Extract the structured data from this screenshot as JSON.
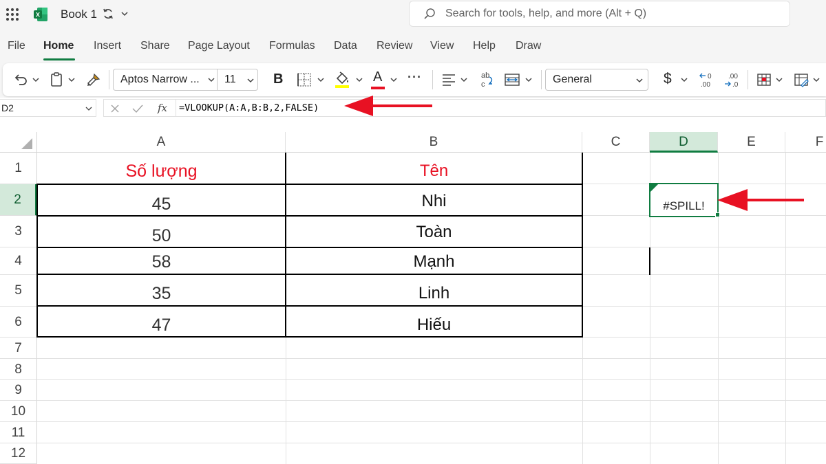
{
  "app": {
    "doc_title": "Book 1",
    "search_placeholder": "Search for tools, help, and more (Alt + Q)"
  },
  "tabs": [
    {
      "label": "File"
    },
    {
      "label": "Home"
    },
    {
      "label": "Insert"
    },
    {
      "label": "Share"
    },
    {
      "label": "Page Layout"
    },
    {
      "label": "Formulas"
    },
    {
      "label": "Data"
    },
    {
      "label": "Review"
    },
    {
      "label": "View"
    },
    {
      "label": "Help"
    },
    {
      "label": "Draw"
    }
  ],
  "toolbar": {
    "font_name": "Aptos Narrow ...",
    "font_size": "11",
    "bold_label": "B",
    "font_color_label": "A",
    "number_format": "General",
    "currency_symbol": "$",
    "more_label": "···",
    "highlight_color": "#ffff00",
    "font_color": "#e81123"
  },
  "formula_bar": {
    "name_box": "D2",
    "fx_label": "fx",
    "formula": "=VLOOKUP(A:A,B:B,2,FALSE)"
  },
  "grid": {
    "columns": [
      "A",
      "B",
      "C",
      "D",
      "E",
      "F"
    ],
    "rows": [
      "1",
      "2",
      "3",
      "4",
      "5",
      "6",
      "7",
      "8",
      "9",
      "10",
      "11",
      "12"
    ],
    "selected_column": "D",
    "selected_row": "2",
    "header_row": {
      "a": "Số lượng",
      "b": "Tên"
    },
    "data_rows": [
      {
        "a": "45",
        "b": "Nhi"
      },
      {
        "a": "50",
        "b": "Toàn"
      },
      {
        "a": "58",
        "b": "Mạnh"
      },
      {
        "a": "35",
        "b": "Linh"
      },
      {
        "a": "47",
        "b": "Hiếu"
      }
    ],
    "active_cell_value": "#SPILL!"
  },
  "colors": {
    "accent_green": "#107c41",
    "header_red": "#e81123",
    "annotation_arrow": "#e81123"
  }
}
